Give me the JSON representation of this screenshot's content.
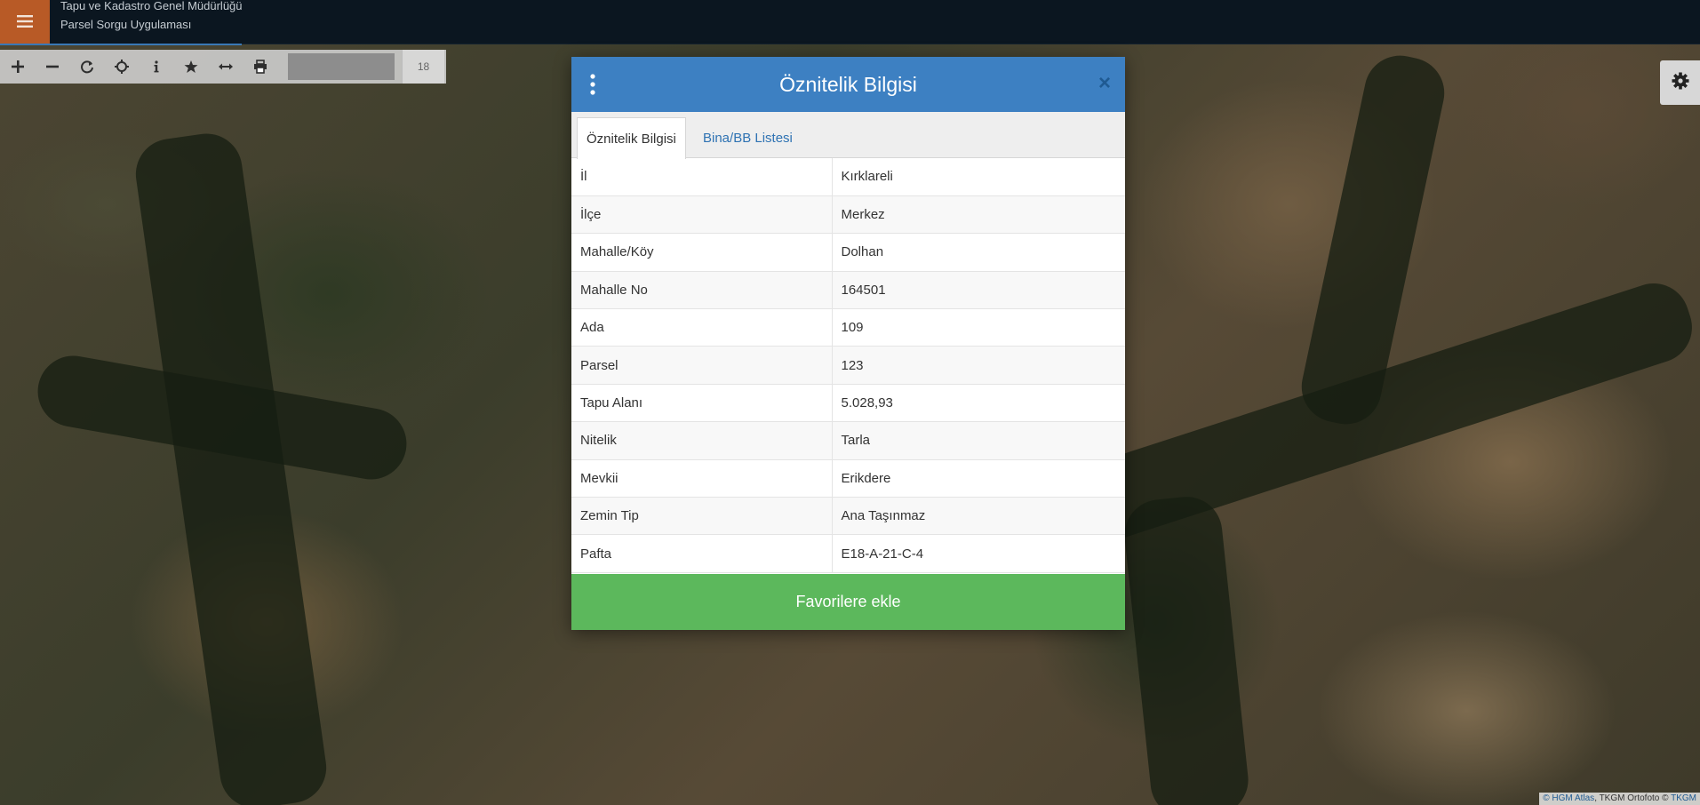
{
  "header": {
    "org_title": "Tapu ve Kadastro Genel Müdürlüğü",
    "app_title": "Parsel Sorgu Uygulaması",
    "menu_icon": "hamburger-icon"
  },
  "toolbar": {
    "tools": [
      "zoom-in-icon",
      "zoom-out-icon",
      "refresh-icon",
      "locate-icon",
      "info-icon",
      "star-icon",
      "measure-icon",
      "print-icon"
    ],
    "zoom_level": "18"
  },
  "settings": {
    "icon": "gear-icon"
  },
  "dialog": {
    "title": "Öznitelik Bilgisi",
    "close_label": "×",
    "tabs": [
      {
        "label": "Öznitelik Bilgisi",
        "active": true
      },
      {
        "label": "Bina/BB Listesi",
        "active": false
      }
    ],
    "rows": [
      {
        "key": "İl",
        "value": "Kırklareli"
      },
      {
        "key": "İlçe",
        "value": "Merkez"
      },
      {
        "key": "Mahalle/Köy",
        "value": "Dolhan"
      },
      {
        "key": "Mahalle No",
        "value": "164501"
      },
      {
        "key": "Ada",
        "value": "109"
      },
      {
        "key": "Parsel",
        "value": "123"
      },
      {
        "key": "Tapu Alanı",
        "value": "5.028,93"
      },
      {
        "key": "Nitelik",
        "value": "Tarla"
      },
      {
        "key": "Mevkii",
        "value": "Erikdere"
      },
      {
        "key": "Zemin Tip",
        "value": "Ana Taşınmaz"
      },
      {
        "key": "Pafta",
        "value": "E18-A-21-C-4"
      }
    ],
    "favorite_button": "Favorilere ekle"
  },
  "attribution": {
    "part1": "© HGM Atlas",
    "part2": ", TKGM Ortofoto ©",
    "part3": " TKGM"
  },
  "colors": {
    "header_blue": "#3d80c2",
    "success_green": "#5cb85c",
    "menu_orange": "#b85a26",
    "topbar_dark": "#0b1620"
  }
}
